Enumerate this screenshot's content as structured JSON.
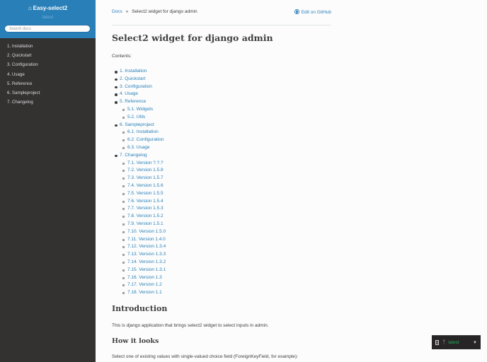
{
  "sidebar": {
    "project_name": "Easy-select2",
    "version": "latest",
    "search_placeholder": "Search docs",
    "items": [
      {
        "label": "1. Installation"
      },
      {
        "label": "2. Quickstart"
      },
      {
        "label": "3. Configuration"
      },
      {
        "label": "4. Usage"
      },
      {
        "label": "5. Reference"
      },
      {
        "label": "6. Sampleproject"
      },
      {
        "label": "7. Changelog"
      }
    ]
  },
  "breadcrumb": {
    "root": "Docs",
    "separator": "»",
    "current": "Select2 widget for django admin",
    "edit_label": "Edit on GitHub"
  },
  "main": {
    "title": "Select2 widget for django admin",
    "contents_label": "Contents:",
    "toc": [
      {
        "label": "1. Installation",
        "level": 1
      },
      {
        "label": "2. Quickstart",
        "level": 1
      },
      {
        "label": "3. Configuration",
        "level": 1
      },
      {
        "label": "4. Usage",
        "level": 1
      },
      {
        "label": "5. Reference",
        "level": 1
      },
      {
        "label": "5.1. Widgets",
        "level": 2
      },
      {
        "label": "5.2. Utils",
        "level": 2
      },
      {
        "label": "6. Sampleproject",
        "level": 1
      },
      {
        "label": "6.1. Installation",
        "level": 2
      },
      {
        "label": "6.2. Configuration",
        "level": 2
      },
      {
        "label": "6.3. Usage",
        "level": 2
      },
      {
        "label": "7. Changelog",
        "level": 1
      },
      {
        "label": "7.1. Version ?.?.?",
        "level": 2
      },
      {
        "label": "7.2. Version 1.5.8",
        "level": 2
      },
      {
        "label": "7.3. Version 1.5.7",
        "level": 2
      },
      {
        "label": "7.4. Version 1.5.6",
        "level": 2
      },
      {
        "label": "7.5. Version 1.5.5",
        "level": 2
      },
      {
        "label": "7.6. Version 1.5.4",
        "level": 2
      },
      {
        "label": "7.7. Version 1.5.3",
        "level": 2
      },
      {
        "label": "7.8. Version 1.5.2",
        "level": 2
      },
      {
        "label": "7.9. Version 1.5.1",
        "level": 2
      },
      {
        "label": "7.10. Version 1.5.0",
        "level": 2
      },
      {
        "label": "7.11. Version 1.4.0",
        "level": 2
      },
      {
        "label": "7.12. Version 1.3.4",
        "level": 2
      },
      {
        "label": "7.13. Version 1.3.3",
        "level": 2
      },
      {
        "label": "7.14. Version 1.3.2",
        "level": 2
      },
      {
        "label": "7.15. Version 1.3.1",
        "level": 2
      },
      {
        "label": "7.16. Version 1.3",
        "level": 2
      },
      {
        "label": "7.17. Version 1.2",
        "level": 2
      },
      {
        "label": "7.18. Version 1.1",
        "level": 2
      }
    ],
    "intro_heading": "Introduction",
    "intro_text": "This is django application that brings select2 widget to select inputs in admin.",
    "how_heading": "How it looks",
    "how_text": "Select one of existing values with single-valued choice field (ForeignKeyField, for example):"
  },
  "flyout": {
    "version": "latest"
  },
  "colors": {
    "sidebar_bg": "#343131",
    "brand_bg": "#2980b9",
    "link": "#2980b9",
    "flyout_version": "#27ae60"
  },
  "icons": [
    "home-icon",
    "github-icon",
    "book-icon",
    "git-branch-icon",
    "caret-down-icon"
  ]
}
